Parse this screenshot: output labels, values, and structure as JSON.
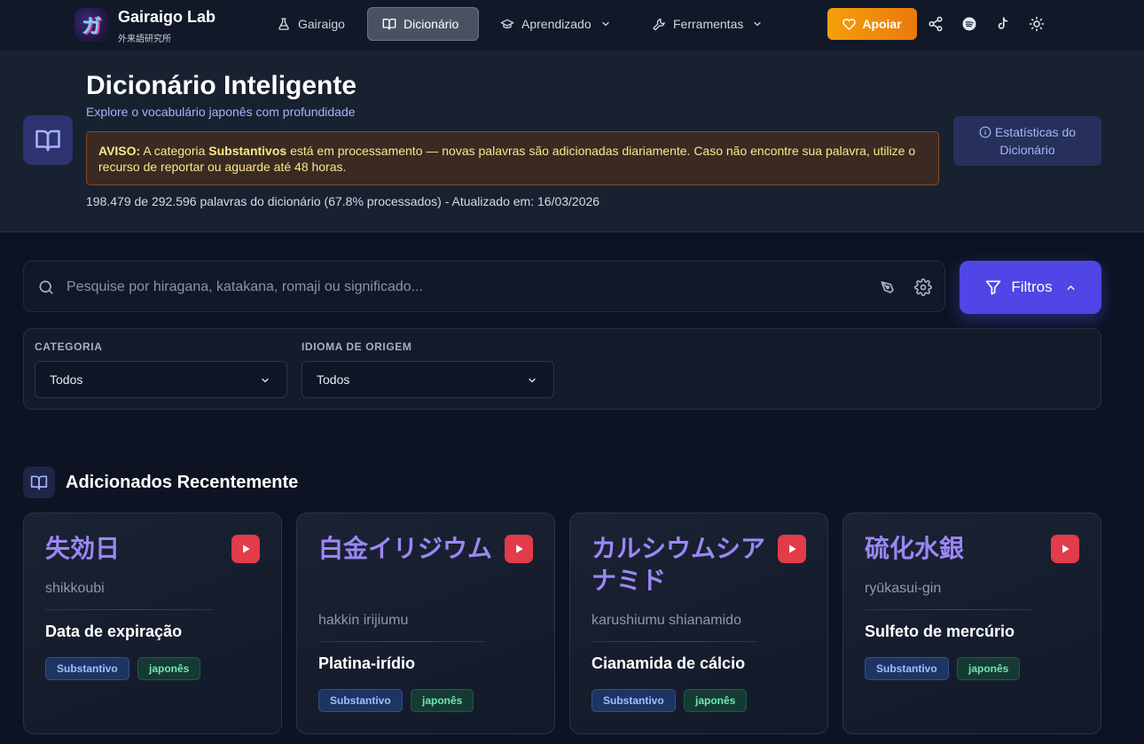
{
  "header": {
    "logo_glyph": "ガ",
    "brand_title": "Gairaigo Lab",
    "brand_subtitle": "外来語研究所",
    "nav": [
      {
        "label": "Gairaigo",
        "icon": "flask-icon"
      },
      {
        "label": "Dicionário",
        "icon": "book-icon",
        "active": true
      },
      {
        "label": "Aprendizado",
        "icon": "graduation-cap-icon",
        "has_dropdown": true
      },
      {
        "label": "Ferramentas",
        "icon": "wrench-icon",
        "has_dropdown": true
      }
    ],
    "support_label": "Apoiar",
    "icons": [
      "share-icon",
      "spotify-icon",
      "tiktok-icon",
      "sun-icon"
    ]
  },
  "hero": {
    "title": "Dicionário Inteligente",
    "subtitle": "Explore o vocabulário japonês com profundidade",
    "warning": {
      "prefix": "AVISO:",
      "text_before": "A categoria",
      "category": "Substantivos",
      "text_after": "está em processamento — novas palavras são adicionadas diariamente. Caso não encontre sua palavra, utilize o recurso de reportar ou aguarde até 48 horas."
    },
    "stats": "198.479 de 292.596 palavras do dicionário (67.8% processados) - Atualizado em: 16/03/2026",
    "stats_button": "Estatísticas do Dicionário"
  },
  "search": {
    "placeholder": "Pesquise por hiragana, katakana, romaji ou significado...",
    "value": "",
    "filter_label": "Filtros"
  },
  "filters": {
    "category_label": "CATEGORIA",
    "category_value": "Todos",
    "origin_label": "IDIOMA DE ORIGEM",
    "origin_value": "Todos"
  },
  "recent": {
    "title": "Adicionados Recentemente",
    "cards": [
      {
        "word": "失効日",
        "romaji": "shikkoubi",
        "meaning": "Data de expiração",
        "category": "Substantivo",
        "language": "japonês"
      },
      {
        "word": "白金イリジウム",
        "romaji": "hakkin irijiumu",
        "meaning": "Platina-irídio",
        "category": "Substantivo",
        "language": "japonês"
      },
      {
        "word": "カルシウムシアナミド",
        "romaji": "karushiumu shianamido",
        "meaning": "Cianamida de cálcio",
        "category": "Substantivo",
        "language": "japonês"
      },
      {
        "word": "硫化水銀",
        "romaji": "ryūkasui-gin",
        "meaning": "Sulfeto de mercúrio",
        "category": "Substantivo",
        "language": "japonês"
      }
    ]
  },
  "colors": {
    "accent": "#4f46e5",
    "support": "#f59e0b",
    "word": "#9b87f5",
    "play": "#e23b4a",
    "warning_text": "#fde68a"
  }
}
